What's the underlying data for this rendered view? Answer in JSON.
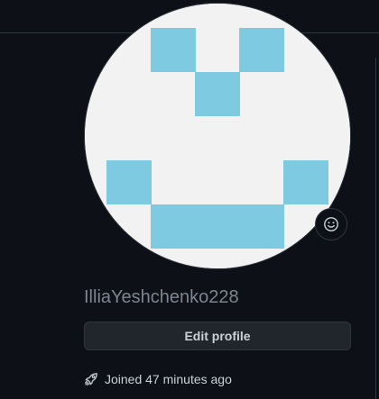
{
  "profile": {
    "username": "IlliaYeshchenko228",
    "edit_label": "Edit profile",
    "joined_text": "Joined 47 minutes ago",
    "avatar_icon": "identicon-avatar",
    "status_icon": "smiley-icon",
    "joined_icon": "rocket-icon"
  },
  "colors": {
    "background": "#0d1117",
    "border": "#30363d",
    "muted_text": "#7d8590",
    "button_bg": "#21262d",
    "identicon_fill": "#7ecbe1",
    "identicon_bg": "#f2f2f2"
  }
}
